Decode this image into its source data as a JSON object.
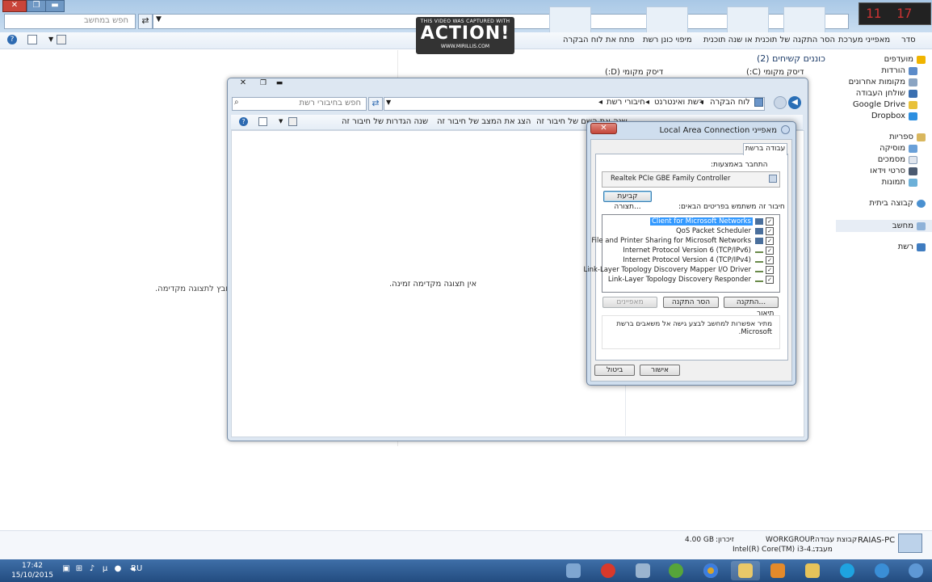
{
  "background_window": {
    "search_placeholder": "חפש במחשב",
    "toolbar": {
      "organize": "סדר",
      "system_properties": "מאפייני מערכת",
      "uninstall": "הסר התקנה של תוכנית או שנה תוכנית",
      "map_drive": "מיפוי כונן רשת",
      "open_control_panel": "פתח את לוח הבקרה"
    },
    "nav": {
      "favorites": "מועדפים",
      "downloads": "הורדות",
      "recent_places": "מקומות אחרונים",
      "desktop": "שולחן העבודה",
      "google_drive": "Google Drive",
      "dropbox": "Dropbox",
      "libraries": "ספריות",
      "music": "מוסיקה",
      "documents": "מסמכים",
      "videos": "סרטי וידאו",
      "pictures": "תמונות",
      "homegroup": "קבוצה ביתית",
      "computer": "מחשב",
      "network": "רשת"
    },
    "section_heading": "כוננים קשיחים (2)",
    "drive_c": "דיסק מקומי (C:)",
    "drive_d": "דיסק מקומי (D:)",
    "preview_text": "קובץ לתצוגה מקדימה.",
    "status": {
      "pc_name": "RAIAS-PC",
      "workgroup_label": "קבוצת עבודה:",
      "workgroup_value": "WORKGROUP",
      "memory_label": "זיכרון:",
      "memory_value": "4.00 GB",
      "processor_label": "מעבד:",
      "processor_value": "Intel(R) Core(TM) i3-4..."
    }
  },
  "watermark": {
    "line1": "THIS VIDEO WAS CAPTURED WITH",
    "brand": "ACTION!",
    "url": "WWW.MIRILLIS.COM"
  },
  "cpu_meter": {
    "left_digits": "11",
    "right_digits": "17"
  },
  "network_window": {
    "search_placeholder": "חפש בחיבורי רשת",
    "breadcrumb": [
      "לוח הבקרה",
      "רשת ואינטרנט",
      "חיבורי רשת"
    ],
    "toolbar": {
      "rename": "שנה הגדרות של חיבור זה",
      "view_status": "הצג את המצב של חיבור זה",
      "rename2": "שנה את השם של חיבור זה"
    },
    "no_preview": "אין תצוגה מקדימה זמינה."
  },
  "dialog": {
    "title": "מאפייני Local Area Connection",
    "tab": "עבודה ברשת",
    "connect_using_label": "התחבר באמצעות:",
    "adapter": "Realtek PCIe GBE Family Controller",
    "configure_button": "קביעת תצורה...",
    "items_label": "חיבור זה משתמש בפריטים הבאים:",
    "items": [
      {
        "label": "Client for Microsoft Networks",
        "checked": true,
        "selected": true
      },
      {
        "label": "QoS Packet Scheduler",
        "checked": true,
        "selected": false
      },
      {
        "label": "File and Printer Sharing for Microsoft Networks",
        "checked": true,
        "selected": false
      },
      {
        "label": "Internet Protocol Version 6 (TCP/IPv6)",
        "checked": true,
        "selected": false
      },
      {
        "label": "Internet Protocol Version 4 (TCP/IPv4)",
        "checked": true,
        "selected": false
      },
      {
        "label": "Link-Layer Topology Discovery Mapper I/O Driver",
        "checked": true,
        "selected": false
      },
      {
        "label": "Link-Layer Topology Discovery Responder",
        "checked": true,
        "selected": false
      }
    ],
    "install_button": "התקנה...",
    "uninstall_button": "הסר התקנה",
    "properties_button": "מאפיינים",
    "description_label": "תיאור",
    "description_text": "מתיר אפשרות למחשב לבצע גישה אל משאבים ברשת Microsoft.",
    "ok_button": "אישור",
    "cancel_button": "ביטול"
  },
  "taskbar": {
    "time": "17:42",
    "date": "15/10/2015",
    "language": "RU"
  }
}
